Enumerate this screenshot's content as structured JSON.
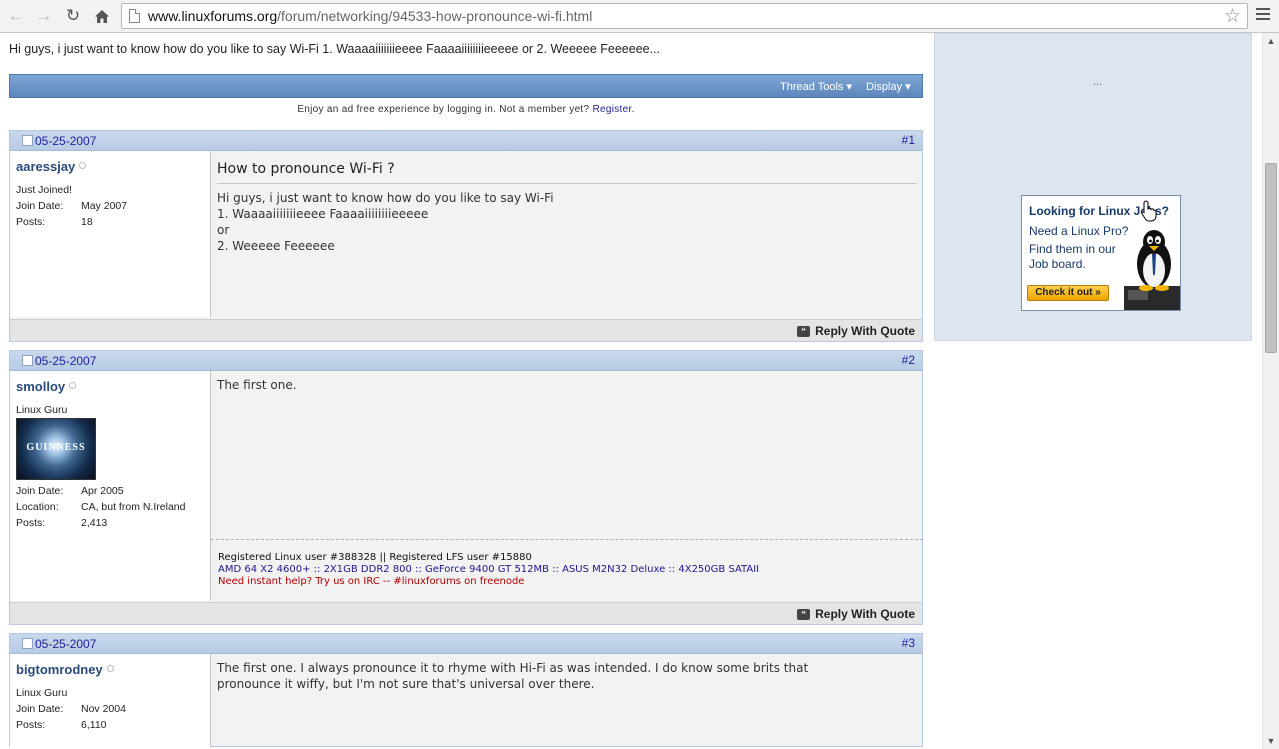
{
  "browser": {
    "url_host": "www.linuxforums.org",
    "url_path": "/forum/networking/94533-how-pronounce-wi-fi.html",
    "icons": [
      "back-arrow-icon",
      "forward-arrow-icon",
      "reload-icon",
      "home-icon",
      "star-icon",
      "menu-icon"
    ]
  },
  "thread": {
    "preview_text": "Hi guys, i just want to know how do you like to say Wi-Fi 1. Waaaaiiiiiiieeee Faaaaiiiiiiiieeeee or 2. Weeeee Feeeeee...",
    "tools": {
      "thread_tools": "Thread Tools",
      "display": "Display"
    },
    "adfree_text": "Enjoy an ad free experience by logging in. Not a member yet?",
    "register_link": "Register."
  },
  "posts": [
    {
      "date": "05-25-2007",
      "number": "#1",
      "username": "aaressjay",
      "user_title": "Just Joined!",
      "fields": [
        {
          "label": "Join Date:",
          "value": "May 2007"
        },
        {
          "label": "Posts:",
          "value": "18"
        }
      ],
      "title": "How to pronounce Wi-Fi ?",
      "lines": [
        "Hi guys, i just want to know how do you like to say Wi-Fi",
        "1. Waaaaiiiiiiieeee Faaaaiiiiiiiieeeee",
        "or",
        "2. Weeeee Feeeeee"
      ],
      "reply_label": "Reply With Quote"
    },
    {
      "date": "05-25-2007",
      "number": "#2",
      "username": "smolloy",
      "user_title": "Linux Guru",
      "avatar_text": "GUINNESS",
      "fields": [
        {
          "label": "Join Date:",
          "value": "Apr 2005"
        },
        {
          "label": "Location:",
          "value": "CA, but from N.Ireland"
        },
        {
          "label": "Posts:",
          "value": "2,413"
        }
      ],
      "lines": [
        "The first one."
      ],
      "signature": [
        "Registered Linux user #388328 || Registered LFS user #15880",
        "AMD 64 X2 4600+ :: 2X1GB DDR2 800 :: GeForce 9400 GT 512MB :: ASUS M2N32 Deluxe :: 4X250GB SATAII",
        "Need instant help? Try us on IRC -- #linuxforums on freenode"
      ],
      "reply_label": "Reply With Quote"
    },
    {
      "date": "05-25-2007",
      "number": "#3",
      "username": "bigtomrodney",
      "user_title": "Linux Guru",
      "fields": [
        {
          "label": "Join Date:",
          "value": "Nov 2004"
        },
        {
          "label": "Posts:",
          "value": "6,110"
        }
      ],
      "lines": [
        "The first one. I always pronounce it to rhyme with Hi-Fi as was intended. I do know some brits that",
        "pronounce it wiffy, but I'm not sure that's universal over there."
      ]
    }
  ],
  "sidebar": {
    "ellipsis": "...",
    "ad": {
      "heading": "Looking for Linux Jobs?",
      "line1": "Need a Linux Pro?",
      "line2": "Find them in our",
      "line3": "Job board.",
      "button": "Check it out »"
    }
  },
  "colors": {
    "link": "#22229c",
    "toolbar": "#6a93c7",
    "signature_red": "#b00000",
    "signature_blue": "#1a1a8a"
  }
}
